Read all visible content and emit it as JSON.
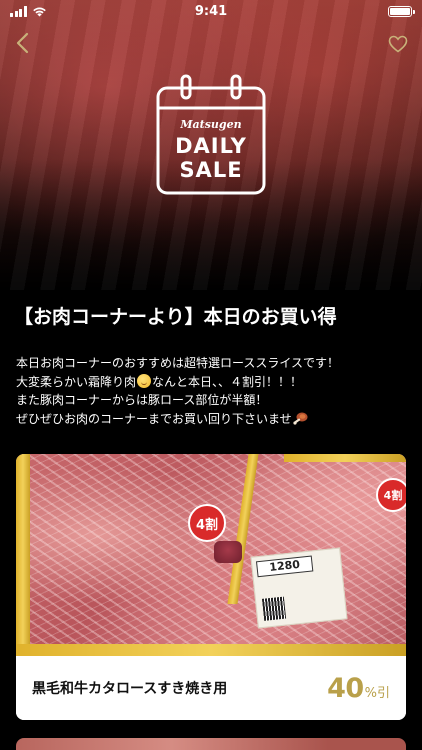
{
  "status_bar": {
    "time": "9:41"
  },
  "hero": {
    "logo": {
      "brand": "Matsugen",
      "line1": "DAILY",
      "line2": "SALE"
    }
  },
  "page": {
    "title": "【お肉コーナーより】本日のお買い得",
    "description": {
      "line1": "本日お肉コーナーのおすすめは超特選ローススライスです！",
      "line2_a": "大変柔らかい霜降り肉",
      "line2_b": "なんと本日、、４割引！！！",
      "line3": "また豚肉コーナーからは豚ロース部位が半額！",
      "line4": "ぜひぜひお肉のコーナーまでお買い回り下さいませ"
    }
  },
  "product": {
    "name": "黒毛和牛カタロースすき焼き用",
    "discount_value": "40",
    "discount_unit": "%引",
    "image_badge": "4割",
    "image_price": "1280"
  },
  "colors": {
    "accent_gold": "#b9a04a",
    "background": "#000000"
  }
}
